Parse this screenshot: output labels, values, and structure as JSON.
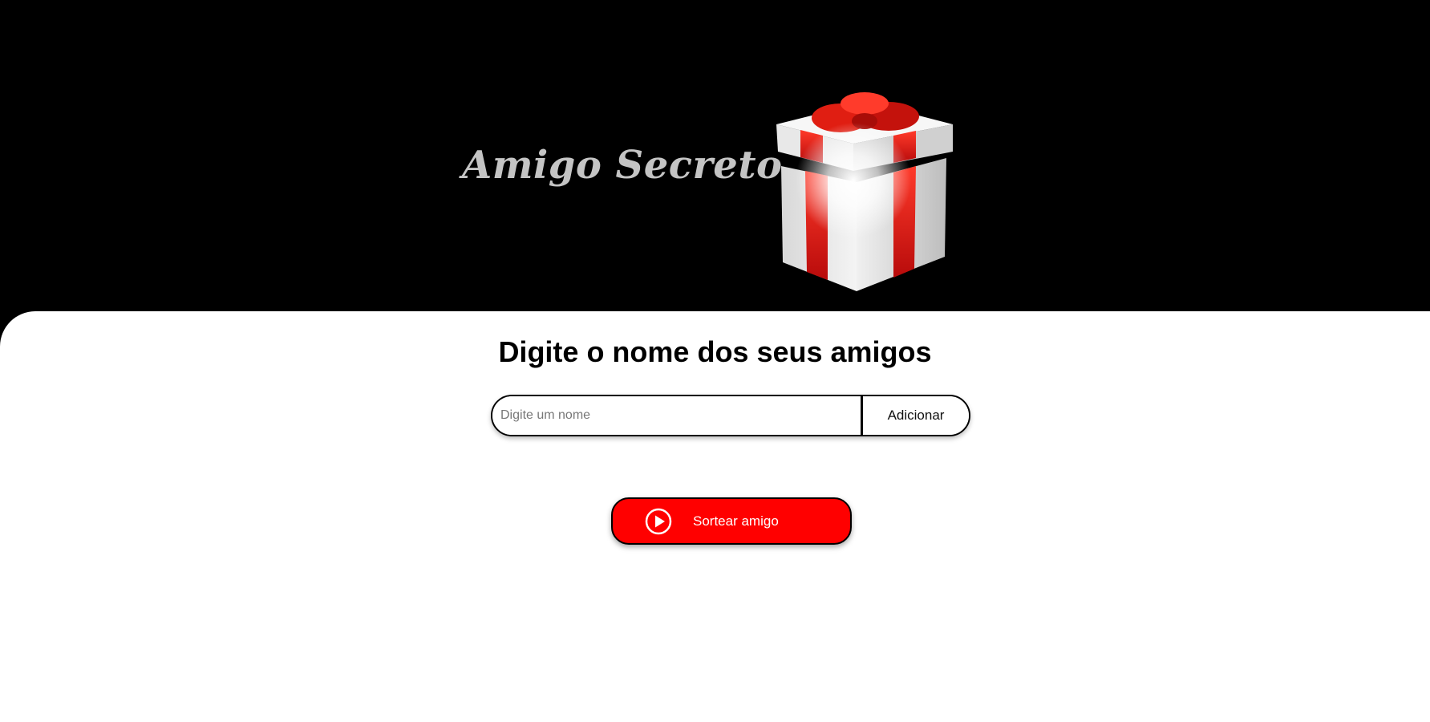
{
  "header": {
    "title": "Amigo Secreto",
    "image_icon": "gift-box-icon"
  },
  "main": {
    "heading": "Digite o nome dos seus amigos",
    "name_input": {
      "value": "",
      "placeholder": "Digite um nome"
    },
    "add_button_label": "Adicionar",
    "draw_button": {
      "label": "Sortear amigo",
      "icon": "play-circle-icon"
    }
  },
  "colors": {
    "header_background": "#000000",
    "title_color": "#c4c4c4",
    "accent_red": "#ff0000",
    "main_background": "#ffffff"
  }
}
